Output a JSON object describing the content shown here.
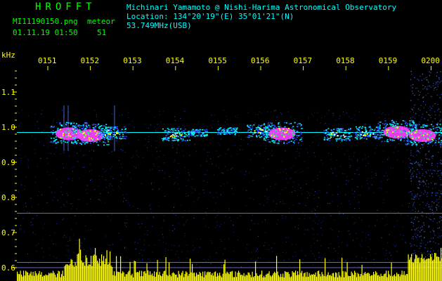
{
  "header": {
    "brand": "HROFFT",
    "filename": "MI11190150.png",
    "datetime": "01.11.19 01:50",
    "meteor_label": "meteor",
    "meteor_count": "51",
    "observer": "Michinari Yamamoto @ Nishi-Harima Astronomical Observatory",
    "location": "Location: 134°20'19\"(E) 35°01'21\"(N)",
    "frequency": "53.749MHz(USB)"
  },
  "chart_data": {
    "type": "heatmap",
    "ylabel": "kHz",
    "x_ticks": [
      "0151",
      "0152",
      "0153",
      "0154",
      "0155",
      "0156",
      "0157",
      "0158",
      "0159",
      "0200"
    ],
    "y_ticks": [
      "1.1",
      "1.0",
      "0.9",
      "0.8",
      "0.7",
      "0.6"
    ],
    "y_tick_values": [
      1.1,
      1.0,
      0.9,
      0.8,
      0.7,
      0.6
    ],
    "ylim": [
      0.57,
      1.26
    ],
    "grid": true,
    "colors": {
      "background": "#000000",
      "carrier": "#00ffff",
      "strong_echo": "#ff40ff",
      "echo": "#00ffff",
      "weak_echo": "#3050ff",
      "noise_bars": "#ffff00",
      "header_green": "#00ff00",
      "header_cyan": "#00ffff",
      "tick_labels": "#ffff00"
    },
    "carrier_frequency_khz": 0.985,
    "reference_lines_khz": [
      0.755,
      0.615,
      0.6
    ],
    "echoes": [
      {
        "time": "0151.5",
        "freq_khz": 0.985,
        "strength": "strong"
      },
      {
        "time": "0152.0",
        "freq_khz": 0.98,
        "strength": "strong"
      },
      {
        "time": "0152.5",
        "freq_khz": 0.985,
        "strength": "medium"
      },
      {
        "time": "0154.0",
        "freq_khz": 0.98,
        "strength": "medium"
      },
      {
        "time": "0154.5",
        "freq_khz": 0.985,
        "strength": "weak"
      },
      {
        "time": "0155.2",
        "freq_khz": 0.99,
        "strength": "weak"
      },
      {
        "time": "0156.0",
        "freq_khz": 0.99,
        "strength": "medium"
      },
      {
        "time": "0156.5",
        "freq_khz": 0.985,
        "strength": "strong"
      },
      {
        "time": "0157.8",
        "freq_khz": 0.98,
        "strength": "medium"
      },
      {
        "time": "0158.5",
        "freq_khz": 0.985,
        "strength": "medium"
      },
      {
        "time": "0159.2",
        "freq_khz": 0.99,
        "strength": "strong"
      },
      {
        "time": "0159.8",
        "freq_khz": 0.98,
        "strength": "strong"
      }
    ]
  }
}
